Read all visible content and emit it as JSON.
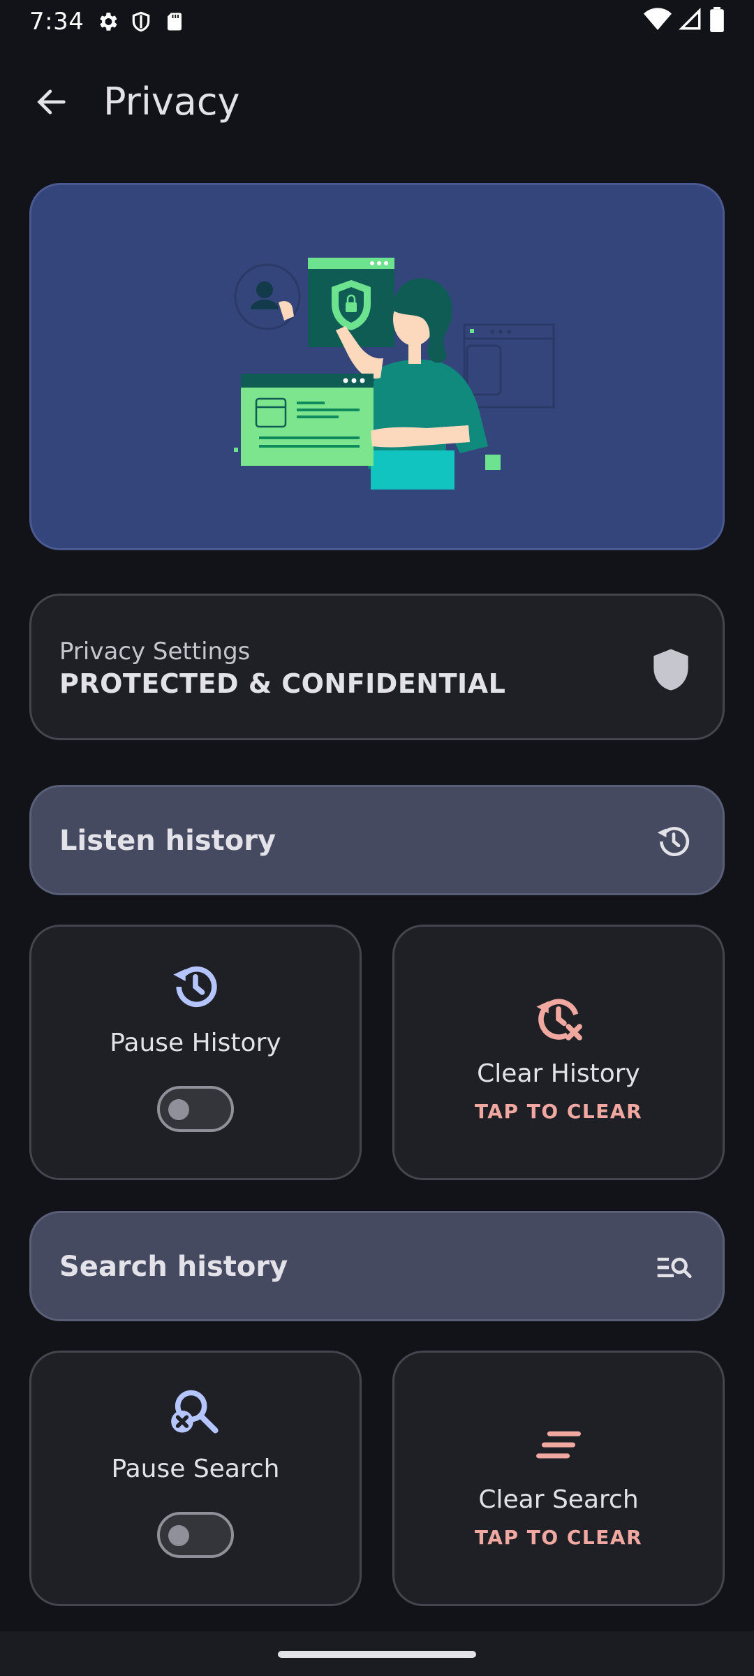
{
  "status_bar": {
    "time": "7:34",
    "icons": [
      "gear-icon",
      "shield-icon",
      "sd-card-icon",
      "wifi-icon",
      "signal-icon",
      "battery-icon"
    ]
  },
  "app_bar": {
    "title": "Privacy",
    "back_icon": "arrow-back-icon"
  },
  "privacy_card": {
    "label": "Privacy Settings",
    "status": "PROTECTED & CONFIDENTIAL",
    "icon": "shield-icon"
  },
  "listen_history": {
    "header": "Listen history",
    "header_icon": "history-icon",
    "pause": {
      "label": "Pause History",
      "icon": "history-icon",
      "enabled": false
    },
    "clear": {
      "label": "Clear History",
      "action": "TAP TO CLEAR",
      "icon": "history-clear-icon"
    }
  },
  "search_history": {
    "header": "Search history",
    "header_icon": "manage-search-icon",
    "pause": {
      "label": "Pause Search",
      "icon": "search-off-icon",
      "enabled": false
    },
    "clear": {
      "label": "Clear Search",
      "action": "TAP TO CLEAR",
      "icon": "clear-all-icon"
    }
  },
  "colors": {
    "background": "#121318",
    "hero": "#33457b",
    "section_header": "#454a61",
    "accent_blue": "#b4c5ff",
    "accent_red": "#f0a8a0"
  }
}
